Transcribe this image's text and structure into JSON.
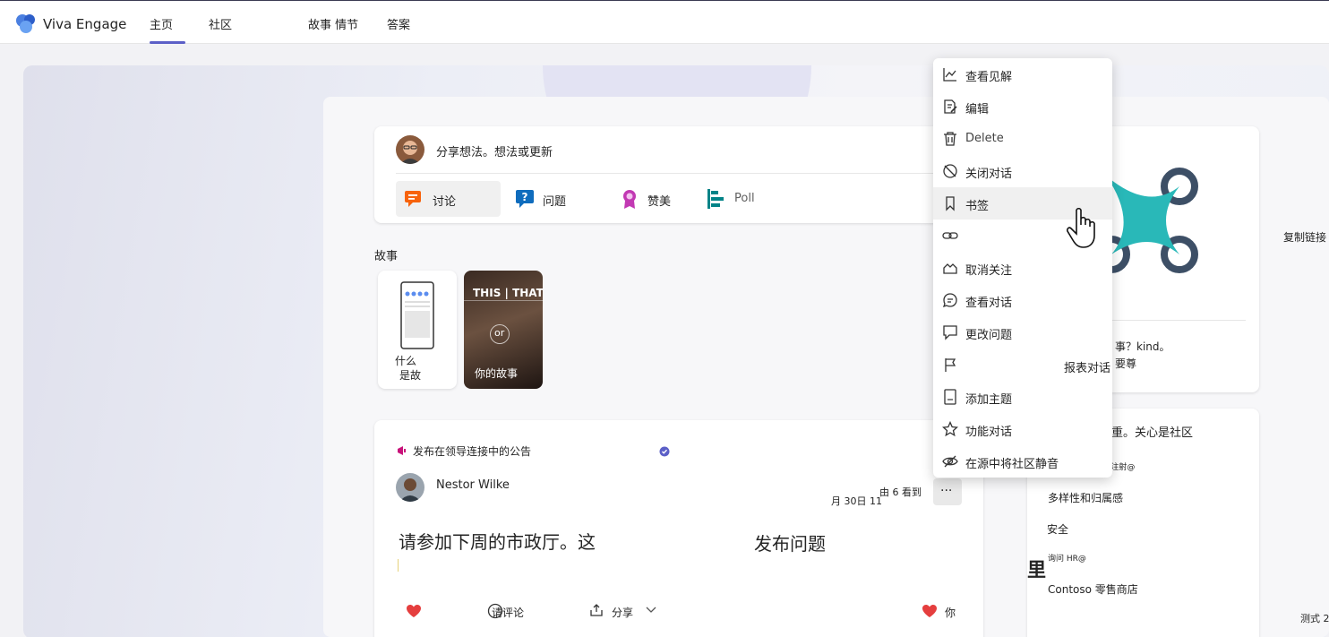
{
  "header": {
    "brand": "Viva Engage",
    "nav": [
      "主页",
      "社区",
      "故事 情节",
      "答案"
    ]
  },
  "composer": {
    "prompt": "分享想法。想法或更新",
    "types": [
      {
        "label": "讨论",
        "color": "#f7630c"
      },
      {
        "label": "问题",
        "color": "#0f6cbd"
      },
      {
        "label": "赞美",
        "color": "#c239b3"
      },
      {
        "label": "Poll",
        "color": "#038387"
      }
    ]
  },
  "stories": {
    "title": "故事",
    "items": [
      {
        "label_line1": "什么",
        "label_line2": "是故"
      },
      {
        "banner": "THIS | THAT",
        "or": "or",
        "label": "你的故事"
      }
    ]
  },
  "post": {
    "announcement": "发布在领导连接中的公告",
    "author": "Nestor Wilke",
    "date": "月 30日 11",
    "views": "由 6 看到",
    "body_left": "请参加下周的市政厅。这",
    "body_right": "发布问题",
    "actions": {
      "comment": "请评论",
      "share": "分享",
      "you": "你"
    }
  },
  "context_menu": {
    "items": [
      {
        "label": "查看见解",
        "icon": "chart-icon"
      },
      {
        "label": "编辑",
        "icon": "edit-icon"
      },
      {
        "label": "Delete",
        "icon": "trash-icon"
      },
      {
        "label": "关闭对话",
        "icon": "close-conversation-icon"
      },
      {
        "label": "书签",
        "icon": "bookmark-icon"
      },
      {
        "label": "",
        "icon": "link-icon"
      },
      {
        "label": "取消关注",
        "icon": "unfollow-icon"
      },
      {
        "label": "查看对话",
        "icon": "chat-icon"
      },
      {
        "label": "更改问题",
        "icon": "change-question-icon"
      },
      {
        "label": "",
        "icon": "flag-icon"
      },
      {
        "label": "添加主题",
        "icon": "topic-icon"
      },
      {
        "label": "功能对话",
        "icon": "star-icon"
      },
      {
        "label": "在源中将社区静音",
        "icon": "mute-icon"
      }
    ],
    "overflow": {
      "copy_link": "复制链接",
      "report": "报表对话"
    }
  },
  "right_panel": {
    "card1_text1": "事？kind。",
    "card1_text2": "要尊",
    "card2_title": "重。关心是社区",
    "items": [
      "i 注射@",
      "多样性和归属感",
      "安全",
      "询问 HR@",
      "Contoso 零售商店"
    ],
    "stray_char": "里",
    "test": "测式 2"
  },
  "colors": {
    "accent": "#5b5fc7",
    "teal": "#29b8b8",
    "navy": "#3d4f66",
    "heart": "#e53e3e"
  }
}
